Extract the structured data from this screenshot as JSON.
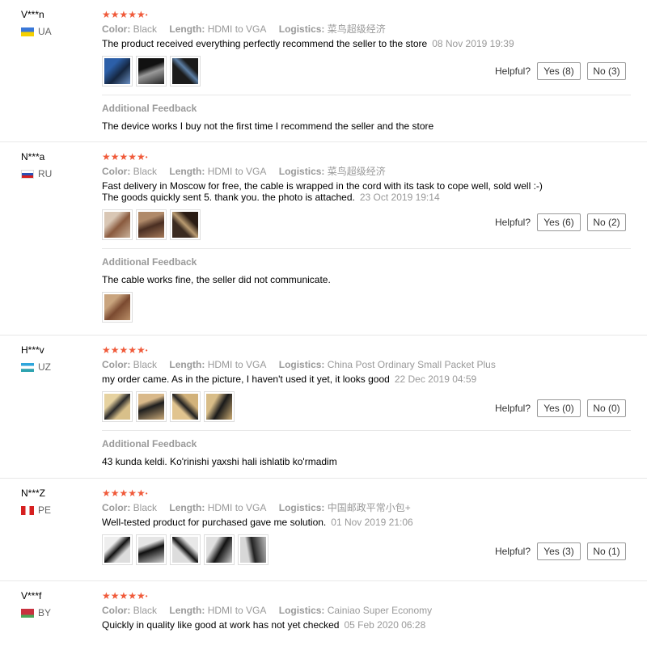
{
  "labels": {
    "color": "Color:",
    "length": "Length:",
    "logistics": "Logistics:",
    "helpful": "Helpful?",
    "additional_feedback": "Additional Feedback"
  },
  "reviews": [
    {
      "user": "V***n",
      "country": "UA",
      "rating": 5,
      "color": "Black",
      "length": "HDMI to VGA",
      "logistics": "菜鸟超级经济",
      "text": "The product received everything perfectly recommend the seller to the store",
      "date": "08 Nov 2019 19:39",
      "yes": "Yes (8)",
      "no": "No (3)",
      "additional_feedback": "The device works I buy not the first time I recommend the seller and the store"
    },
    {
      "user": "N***a",
      "country": "RU",
      "rating": 5,
      "color": "Black",
      "length": "HDMI to VGA",
      "logistics": "菜鸟超级经济",
      "text_line1": "Fast delivery in Moscow for free, the cable is wrapped in the cord with its task to cope well, sold well :-)",
      "text_line2": "The goods quickly sent 5. thank you. the photo is attached.",
      "date": "23 Oct 2019 19:14",
      "yes": "Yes (6)",
      "no": "No (2)",
      "additional_feedback": "The cable works fine, the seller did not communicate."
    },
    {
      "user": "H***v",
      "country": "UZ",
      "rating": 5,
      "color": "Black",
      "length": "HDMI to VGA",
      "logistics": "China Post Ordinary Small Packet Plus",
      "text": "my order came. As in the picture, I haven't used it yet, it looks good",
      "date": "22 Dec 2019 04:59",
      "yes": "Yes (0)",
      "no": "No (0)",
      "additional_feedback": "43 kunda keldi. Ko'rinishi yaxshi hali ishlatib ko'rmadim"
    },
    {
      "user": "N***Z",
      "country": "PE",
      "rating": 5,
      "color": "Black",
      "length": "HDMI to VGA",
      "logistics": "中国邮政平常小包+",
      "text": "Well-tested product for purchased gave me solution.",
      "date": "01 Nov 2019 21:06",
      "yes": "Yes (3)",
      "no": "No (1)"
    },
    {
      "user": "V***f",
      "country": "BY",
      "rating": 5,
      "color": "Black",
      "length": "HDMI to VGA",
      "logistics": "Cainiao Super Economy",
      "text": "Quickly in quality like good at work has not yet checked",
      "date": "05 Feb 2020 06:28"
    }
  ]
}
